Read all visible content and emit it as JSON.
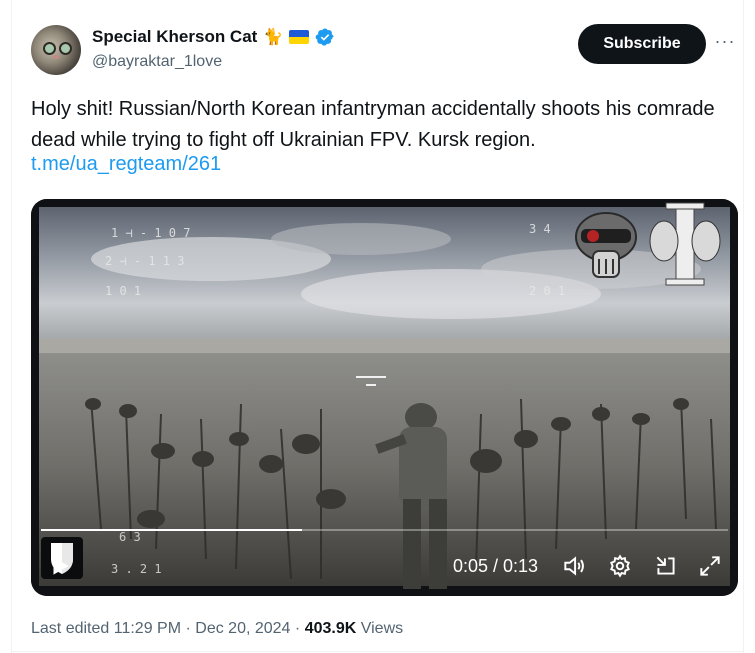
{
  "author": {
    "display_name": "Special Kherson Cat",
    "name_emoji": "🐈",
    "handle": "@bayraktar_1love"
  },
  "actions": {
    "subscribe_label": "Subscribe",
    "more_label": "···"
  },
  "post": {
    "text": "Holy shit! Russian/North Korean infantryman accidentally shoots his comrade dead while trying to fight off Ukrainian FPV. Kursk region.",
    "link": "t.me/ua_regteam/261"
  },
  "video": {
    "time_display": "0:05 / 0:13",
    "progress": 0.38,
    "osd_lines": [
      "1 ⊣ - 1 0 7",
      "2 ⊣ - 1 1 3",
      "1 0 1"
    ],
    "osd_right": [
      "3 4",
      "2 0 1"
    ],
    "osd_bottom": [
      "6 3",
      "3 . 2 1"
    ]
  },
  "meta": {
    "edited_label": "Last edited",
    "time": "11:29 PM",
    "date": "Dec 20, 2024",
    "views_count": "403.9K",
    "views_label": "Views"
  },
  "colors": {
    "accent": "#1d9bf0",
    "muted": "#536471",
    "primary_text": "#0f1419"
  }
}
